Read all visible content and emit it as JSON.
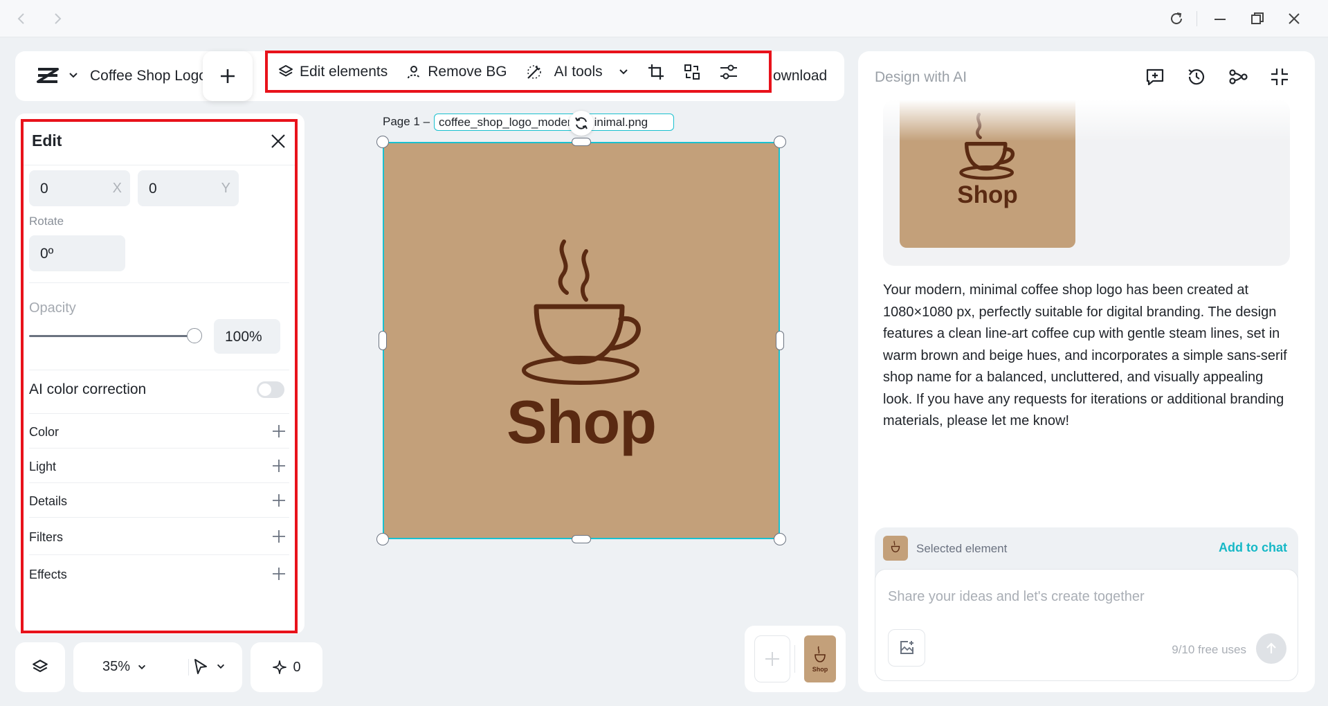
{
  "window": {
    "back_icon": "chevron-left-icon",
    "forward_icon": "chevron-right-icon",
    "reload_icon": "reload-icon",
    "minimize_icon": "minimize-icon",
    "restore_icon": "restore-icon",
    "close_icon": "close-icon"
  },
  "header": {
    "doc_title": "Coffee Shop Logo",
    "tools": {
      "edit_elements": "Edit elements",
      "remove_bg": "Remove BG",
      "ai_tools": "AI tools"
    },
    "download_label": "ownload"
  },
  "edit_panel": {
    "title": "Edit",
    "x_value": "0",
    "x_unit": "X",
    "y_value": "0",
    "y_unit": "Y",
    "rotate_label": "Rotate",
    "rotate_value": "0º",
    "opacity_label": "Opacity",
    "opacity_value": "100%",
    "opacity_fraction": 1.0,
    "ai_color_correction_label": "AI color correction",
    "ai_color_correction_on": false,
    "sections": [
      "Color",
      "Light",
      "Details",
      "Filters",
      "Effects"
    ]
  },
  "bottom_controls": {
    "zoom": "35%",
    "ai_count": "0"
  },
  "canvas": {
    "page_label": "Page 1 –",
    "file_name": "coffee_shop_logo_modern_minimal.png",
    "logo_text": "Shop",
    "bg_color": "#c3a07a",
    "ink_color": "#5a2a12",
    "selection_color": "#19c0cf"
  },
  "pages": {
    "thumb_text": "Shop"
  },
  "ai_panel": {
    "title": "Design with AI",
    "preview_text": "Shop",
    "message": "Your modern, minimal coffee shop logo has been created at 1080×1080 px, perfectly suitable for digital branding. The design features a clean line-art coffee cup with gentle steam lines, set in warm brown and beige hues, and incorporates a simple sans-serif shop name for a balanced, uncluttered, and visually appealing look. If you have any requests for iterations or additional branding materials, please let me know!",
    "selected_element_label": "Selected element",
    "add_to_chat_label": "Add to chat",
    "input_placeholder": "Share your ideas and let's create together",
    "free_uses": "9/10 free uses",
    "accent": "#16b8c6"
  }
}
